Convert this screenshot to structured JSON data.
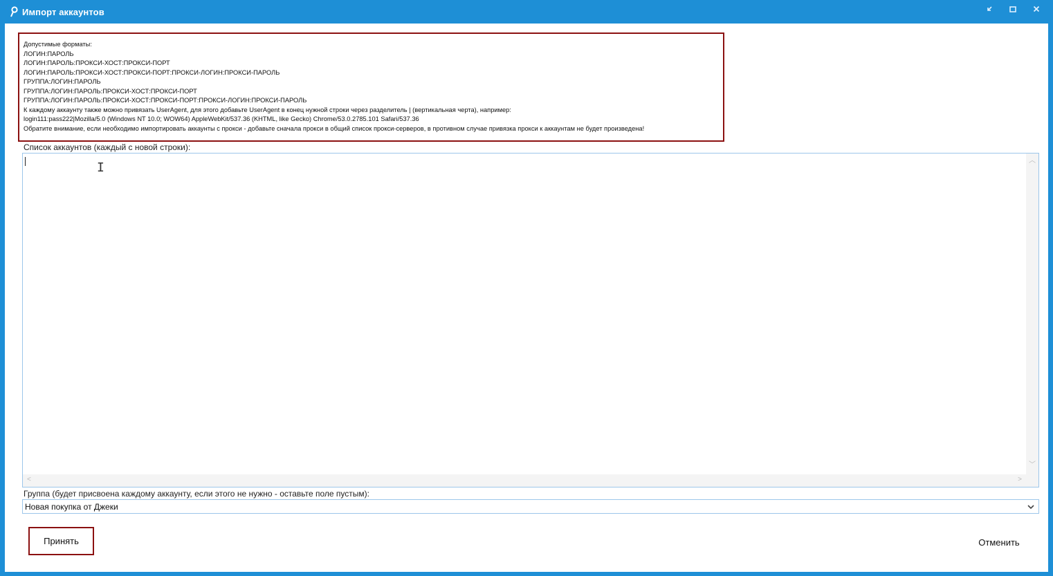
{
  "window": {
    "title": "Импорт аккаунтов",
    "icon": "pin-icon",
    "controls": [
      "restore-down-icon",
      "maximize-icon",
      "close-icon"
    ]
  },
  "info": {
    "lines": [
      "Допустимые форматы:",
      "ЛОГИН:ПАРОЛЬ",
      "ЛОГИН:ПАРОЛЬ:ПРОКСИ-ХОСТ:ПРОКСИ-ПОРТ",
      "ЛОГИН:ПАРОЛЬ:ПРОКСИ-ХОСТ:ПРОКСИ-ПОРТ:ПРОКСИ-ЛОГИН:ПРОКСИ-ПАРОЛЬ",
      "ГРУППА:ЛОГИН:ПАРОЛЬ",
      "ГРУППА:ЛОГИН:ПАРОЛЬ:ПРОКСИ-ХОСТ:ПРОКСИ-ПОРТ",
      "ГРУППА:ЛОГИН:ПАРОЛЬ:ПРОКСИ-ХОСТ:ПРОКСИ-ПОРТ:ПРОКСИ-ЛОГИН:ПРОКСИ-ПАРОЛЬ",
      "К каждому аккаунту также можно привязать UserAgent, для этого добавьте UserAgent в конец нужной строки через разделитель | (вертикальная черта), например:",
      "login111:pass222|Mozilla/5.0 (Windows NT 10.0; WOW64) AppleWebKit/537.36 (KHTML, like Gecko) Chrome/53.0.2785.101 Safari/537.36",
      "Обратите внимание, если необходимо импортировать аккаунты с прокси - добавьте сначала прокси в общий список прокси-серверов, в противном случае привязка прокси к аккаунтам не будет произведена!"
    ]
  },
  "accounts": {
    "label": "Список аккаунтов (каждый с новой строки):",
    "value": ""
  },
  "group": {
    "label": "Группа (будет присвоена каждому аккаунту, если этого не нужно - оставьте поле пустым):",
    "selected": "Новая покупка от Джеки"
  },
  "buttons": {
    "accept": "Принять",
    "cancel": "Отменить"
  },
  "colors": {
    "titlebar": "#1e8fd6",
    "highlight_border": "#8b1010",
    "field_border": "#9cc6ea"
  }
}
